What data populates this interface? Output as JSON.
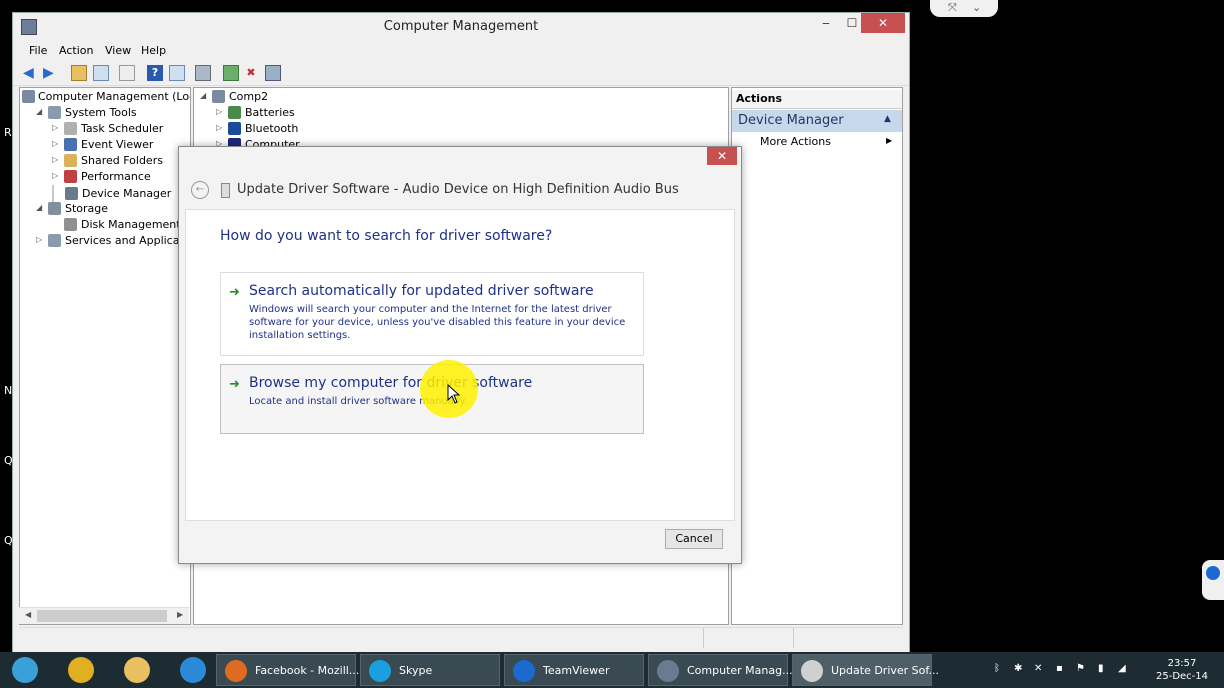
{
  "window": {
    "title": "Computer Management",
    "buttons": {
      "minimize": "‒",
      "maximize": "☐",
      "close": "✕"
    }
  },
  "menu": [
    "File",
    "Action",
    "View",
    "Help"
  ],
  "left_tree": [
    {
      "label": "Computer Management (Local",
      "level": 0,
      "expander": "",
      "icon": "computer-icon",
      "color": "#7a8aa0"
    },
    {
      "label": "System Tools",
      "level": 1,
      "expander": "◢",
      "icon": "tools-icon",
      "color": "#8a9bb0"
    },
    {
      "label": "Task Scheduler",
      "level": 2,
      "expander": "▷",
      "icon": "clock-icon",
      "color": "#b0b0b0"
    },
    {
      "label": "Event Viewer",
      "level": 2,
      "expander": "▷",
      "icon": "event-viewer-icon",
      "color": "#4a70b0"
    },
    {
      "label": "Shared Folders",
      "level": 2,
      "expander": "▷",
      "icon": "shared-folder-icon",
      "color": "#d9b35a"
    },
    {
      "label": "Performance",
      "level": 2,
      "expander": "▷",
      "icon": "performance-icon",
      "color": "#c04040"
    },
    {
      "label": "Device Manager",
      "level": 2,
      "expander": "",
      "icon": "device-manager-icon",
      "color": "#6a7a8a",
      "selected": true
    },
    {
      "label": "Storage",
      "level": 1,
      "expander": "◢",
      "icon": "storage-icon",
      "color": "#8090a0"
    },
    {
      "label": "Disk Management",
      "level": 2,
      "expander": "",
      "icon": "disk-icon",
      "color": "#909090"
    },
    {
      "label": "Services and Applications",
      "level": 1,
      "expander": "▷",
      "icon": "services-icon",
      "color": "#8a9bb0"
    }
  ],
  "device_tree": [
    {
      "label": "Comp2",
      "level": 0,
      "expander": "◢",
      "icon": "computer-icon",
      "color": "#7a8aa0"
    },
    {
      "label": "Batteries",
      "level": 1,
      "expander": "▷",
      "icon": "battery-icon",
      "color": "#4a8a4a"
    },
    {
      "label": "Bluetooth",
      "level": 1,
      "expander": "▷",
      "icon": "bluetooth-icon",
      "color": "#1a4a9a"
    },
    {
      "label": "Computer",
      "level": 1,
      "expander": "▷",
      "icon": "computer-icon",
      "color": "#1a2a7a"
    }
  ],
  "actions": {
    "header": "Actions",
    "section": "Device Manager",
    "section_toggle": "▲",
    "items": [
      {
        "label": "More Actions",
        "arrow": "▶"
      }
    ]
  },
  "dialog": {
    "title": "Update Driver Software - Audio Device on High Definition Audio Bus",
    "close": "✕",
    "back": "←",
    "question": "How do you want to search for driver software?",
    "options": [
      {
        "arrow": "➜",
        "title": "Search automatically for updated driver software",
        "desc": "Windows will search your computer and the Internet for the latest driver software for your device, unless you've disabled this feature in your device installation settings."
      },
      {
        "arrow": "➜",
        "title": "Browse my computer for driver software",
        "desc": "Locate and install driver software manually."
      }
    ],
    "cancel": "Cancel"
  },
  "taskbar": {
    "pinned": [
      {
        "name": "people-icon",
        "color": "#3aa0d8"
      },
      {
        "name": "chrome-icon",
        "color": "#e0b020"
      },
      {
        "name": "file-explorer-icon",
        "color": "#e8c060"
      },
      {
        "name": "internet-explorer-icon",
        "color": "#2a8ad8"
      }
    ],
    "apps": [
      {
        "label": "Facebook - Mozill...",
        "icon": "firefox-icon",
        "color": "#e06a20"
      },
      {
        "label": "Skype",
        "icon": "skype-icon",
        "color": "#1aa0e0"
      },
      {
        "label": "TeamViewer",
        "icon": "teamviewer-icon",
        "color": "#1a6ad0"
      },
      {
        "label": "Computer Manag...",
        "icon": "computer-management-icon",
        "color": "#6a7a90"
      },
      {
        "label": "Update Driver Sof...",
        "icon": "device-icon",
        "color": "#d0d0d0"
      }
    ],
    "time": "23:57",
    "date": "25-Dec-14"
  }
}
